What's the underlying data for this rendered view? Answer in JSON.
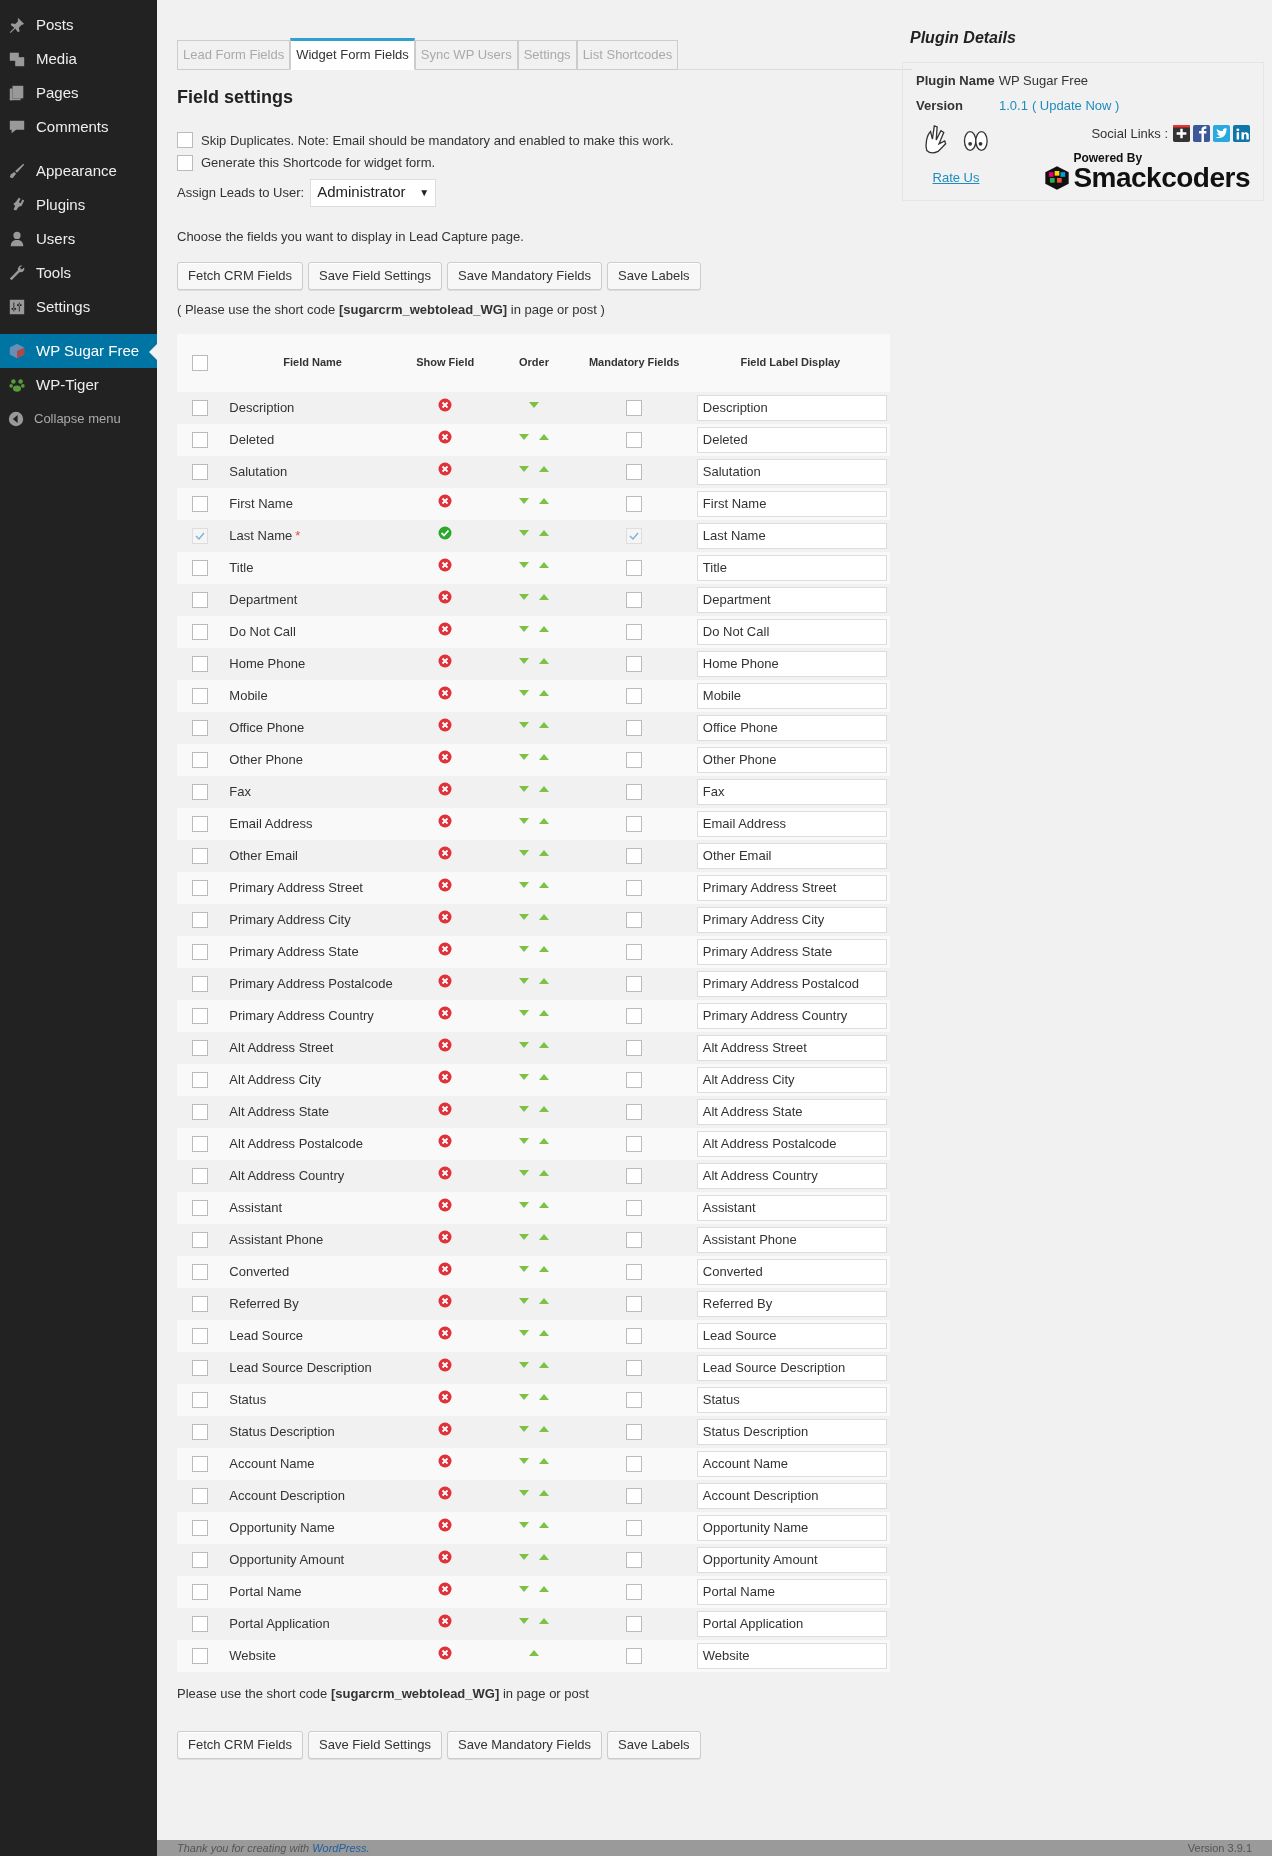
{
  "sidebar": {
    "groups": [
      [
        {
          "label": "Posts",
          "selected": false
        },
        {
          "label": "Media",
          "selected": false
        },
        {
          "label": "Pages",
          "selected": false
        },
        {
          "label": "Comments",
          "selected": false
        }
      ],
      [
        {
          "label": "Appearance",
          "selected": false
        },
        {
          "label": "Plugins",
          "selected": false
        },
        {
          "label": "Users",
          "selected": false
        },
        {
          "label": "Tools",
          "selected": false
        },
        {
          "label": "Settings",
          "selected": false
        }
      ],
      [
        {
          "label": "WP Sugar Free",
          "selected": true
        },
        {
          "label": "WP-Tiger",
          "selected": false
        }
      ]
    ],
    "collapse": "Collapse menu"
  },
  "tabs": [
    {
      "label": "Lead Form Fields",
      "selected": false
    },
    {
      "label": "Widget Form Fields",
      "selected": true
    },
    {
      "label": "Sync WP Users",
      "selected": false
    },
    {
      "label": "Settings",
      "selected": false
    },
    {
      "label": "List Shortcodes",
      "selected": false
    }
  ],
  "heading": "Field settings",
  "options": [
    {
      "label": "Skip Duplicates. Note: Email should be mandatory and enabled to make this work.",
      "checked": false
    },
    {
      "label": "Generate this Shortcode for widget form.",
      "checked": false
    }
  ],
  "assign": {
    "label": "Assign Leads to User:",
    "value": "Administrator",
    "caret": "▼"
  },
  "intro": "Choose the fields you want to display in Lead Capture page.",
  "buttons": [
    "Fetch CRM Fields",
    "Save Field Settings",
    "Save Mandatory Fields",
    "Save Labels"
  ],
  "shortcode_note": "( Please use the short code **[sugarcrm_webtolead_WG]** in page or post )",
  "table": {
    "columns": [
      "Field Name",
      "Show Field",
      "Order",
      "Mandatory Fields",
      "Field Label Display"
    ],
    "all_checked": false,
    "rows": [
      {
        "name": "Description",
        "selected": false,
        "shown": false,
        "down": true,
        "up": false,
        "mandatory": false,
        "label": "Description"
      },
      {
        "name": "Deleted",
        "selected": false,
        "shown": false,
        "down": true,
        "up": true,
        "mandatory": false,
        "label": "Deleted"
      },
      {
        "name": "Salutation",
        "selected": false,
        "shown": false,
        "down": true,
        "up": true,
        "mandatory": false,
        "label": "Salutation"
      },
      {
        "name": "First Name",
        "selected": false,
        "shown": false,
        "down": true,
        "up": true,
        "mandatory": false,
        "label": "First Name"
      },
      {
        "name": "Last Name",
        "selected": true,
        "marker": "*",
        "shown": true,
        "down": true,
        "up": true,
        "mandatory": true,
        "label": "Last Name"
      },
      {
        "name": "Title",
        "selected": false,
        "shown": false,
        "down": true,
        "up": true,
        "mandatory": false,
        "label": "Title"
      },
      {
        "name": "Department",
        "selected": false,
        "shown": false,
        "down": true,
        "up": true,
        "mandatory": false,
        "label": "Department"
      },
      {
        "name": "Do Not Call",
        "selected": false,
        "shown": false,
        "down": true,
        "up": true,
        "mandatory": false,
        "label": "Do Not Call"
      },
      {
        "name": "Home Phone",
        "selected": false,
        "shown": false,
        "down": true,
        "up": true,
        "mandatory": false,
        "label": "Home Phone"
      },
      {
        "name": "Mobile",
        "selected": false,
        "shown": false,
        "down": true,
        "up": true,
        "mandatory": false,
        "label": "Mobile"
      },
      {
        "name": "Office Phone",
        "selected": false,
        "shown": false,
        "down": true,
        "up": true,
        "mandatory": false,
        "label": "Office Phone"
      },
      {
        "name": "Other Phone",
        "selected": false,
        "shown": false,
        "down": true,
        "up": true,
        "mandatory": false,
        "label": "Other Phone"
      },
      {
        "name": "Fax",
        "selected": false,
        "shown": false,
        "down": true,
        "up": true,
        "mandatory": false,
        "label": "Fax"
      },
      {
        "name": "Email Address",
        "selected": false,
        "shown": false,
        "down": true,
        "up": true,
        "mandatory": false,
        "label": "Email Address"
      },
      {
        "name": "Other Email",
        "selected": false,
        "shown": false,
        "down": true,
        "up": true,
        "mandatory": false,
        "label": "Other Email"
      },
      {
        "name": "Primary Address Street",
        "selected": false,
        "shown": false,
        "down": true,
        "up": true,
        "mandatory": false,
        "label": "Primary Address Street"
      },
      {
        "name": "Primary Address City",
        "selected": false,
        "shown": false,
        "down": true,
        "up": true,
        "mandatory": false,
        "label": "Primary Address City"
      },
      {
        "name": "Primary Address State",
        "selected": false,
        "shown": false,
        "down": true,
        "up": true,
        "mandatory": false,
        "label": "Primary Address State"
      },
      {
        "name": "Primary Address Postalcode",
        "selected": false,
        "shown": false,
        "down": true,
        "up": true,
        "mandatory": false,
        "label": "Primary Address Postalcod"
      },
      {
        "name": "Primary Address Country",
        "selected": false,
        "shown": false,
        "down": true,
        "up": true,
        "mandatory": false,
        "label": "Primary Address Country"
      },
      {
        "name": "Alt Address Street",
        "selected": false,
        "shown": false,
        "down": true,
        "up": true,
        "mandatory": false,
        "label": "Alt Address Street"
      },
      {
        "name": "Alt Address City",
        "selected": false,
        "shown": false,
        "down": true,
        "up": true,
        "mandatory": false,
        "label": "Alt Address City"
      },
      {
        "name": "Alt Address State",
        "selected": false,
        "shown": false,
        "down": true,
        "up": true,
        "mandatory": false,
        "label": "Alt Address State"
      },
      {
        "name": "Alt Address Postalcode",
        "selected": false,
        "shown": false,
        "down": true,
        "up": true,
        "mandatory": false,
        "label": "Alt Address Postalcode"
      },
      {
        "name": "Alt Address Country",
        "selected": false,
        "shown": false,
        "down": true,
        "up": true,
        "mandatory": false,
        "label": "Alt Address Country"
      },
      {
        "name": "Assistant",
        "selected": false,
        "shown": false,
        "down": true,
        "up": true,
        "mandatory": false,
        "label": "Assistant"
      },
      {
        "name": "Assistant Phone",
        "selected": false,
        "shown": false,
        "down": true,
        "up": true,
        "mandatory": false,
        "label": "Assistant Phone"
      },
      {
        "name": "Converted",
        "selected": false,
        "shown": false,
        "down": true,
        "up": true,
        "mandatory": false,
        "label": "Converted"
      },
      {
        "name": "Referred By",
        "selected": false,
        "shown": false,
        "down": true,
        "up": true,
        "mandatory": false,
        "label": "Referred By"
      },
      {
        "name": "Lead Source",
        "selected": false,
        "shown": false,
        "down": true,
        "up": true,
        "mandatory": false,
        "label": "Lead Source"
      },
      {
        "name": "Lead Source Description",
        "selected": false,
        "shown": false,
        "down": true,
        "up": true,
        "mandatory": false,
        "label": "Lead Source Description"
      },
      {
        "name": "Status",
        "selected": false,
        "shown": false,
        "down": true,
        "up": true,
        "mandatory": false,
        "label": "Status"
      },
      {
        "name": "Status Description",
        "selected": false,
        "shown": false,
        "down": true,
        "up": true,
        "mandatory": false,
        "label": "Status Description"
      },
      {
        "name": "Account Name",
        "selected": false,
        "shown": false,
        "down": true,
        "up": true,
        "mandatory": false,
        "label": "Account Name"
      },
      {
        "name": "Account Description",
        "selected": false,
        "shown": false,
        "down": true,
        "up": true,
        "mandatory": false,
        "label": "Account Description"
      },
      {
        "name": "Opportunity Name",
        "selected": false,
        "shown": false,
        "down": true,
        "up": true,
        "mandatory": false,
        "label": "Opportunity Name"
      },
      {
        "name": "Opportunity Amount",
        "selected": false,
        "shown": false,
        "down": true,
        "up": true,
        "mandatory": false,
        "label": "Opportunity Amount"
      },
      {
        "name": "Portal Name",
        "selected": false,
        "shown": false,
        "down": true,
        "up": true,
        "mandatory": false,
        "label": "Portal Name"
      },
      {
        "name": "Portal Application",
        "selected": false,
        "shown": false,
        "down": true,
        "up": true,
        "mandatory": false,
        "label": "Portal Application"
      },
      {
        "name": "Website",
        "selected": false,
        "shown": false,
        "down": false,
        "up": true,
        "mandatory": false,
        "label": "Website"
      }
    ]
  },
  "footer_note": "Please use the short code **[sugarcrm_webtolead_WG]** in page or post",
  "bottom_buttons": [
    "Fetch CRM Fields",
    "Save Field Settings",
    "Save Mandatory Fields",
    "Save Labels"
  ],
  "plugin_details": {
    "title": "Plugin Details",
    "name_label": "Plugin Name",
    "name": "WP Sugar Free",
    "version_label": "Version",
    "version": "1.0.1",
    "update_link": "( Update Now )",
    "social_label": "Social Links :",
    "rate": "Rate Us",
    "powered_by": "Powered By",
    "brand": "Smackcoders"
  },
  "wp_footer": {
    "text": "Thank you for creating with",
    "link": "WordPress.",
    "version": "Version 3.9.1"
  }
}
